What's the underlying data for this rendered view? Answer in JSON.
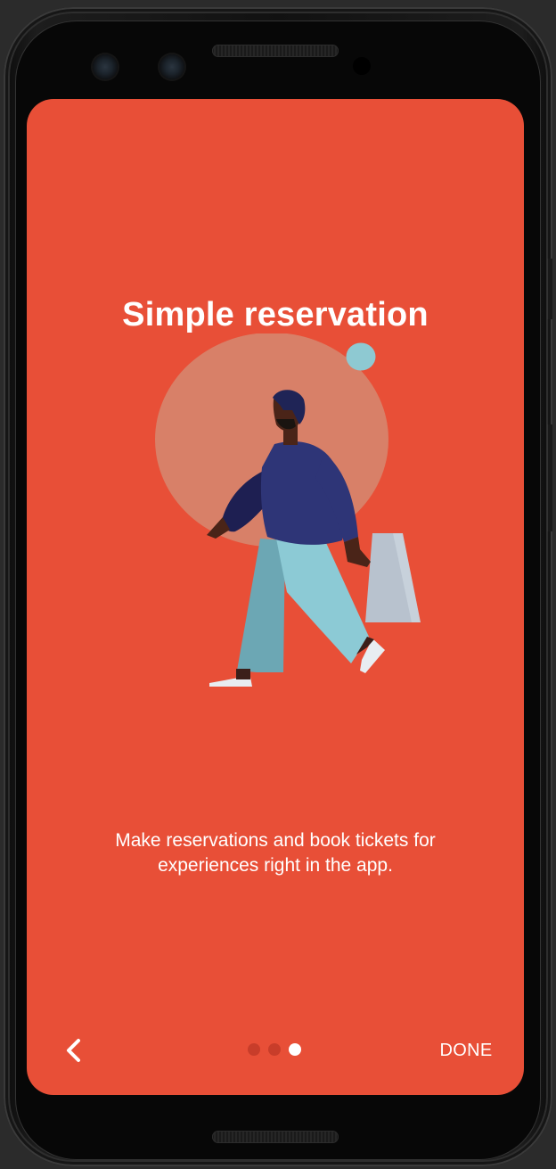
{
  "onboarding": {
    "title": "Simple reservation",
    "description": "Make reservations and book tickets for experiences right in the app.",
    "done_label": "DONE",
    "back_icon": "chevron-left-icon",
    "page_indicator": {
      "total": 3,
      "current": 3
    }
  },
  "theme": {
    "background": "#E84F37",
    "text": "#FFFFFF",
    "dot_inactive": "#C2402C",
    "dot_active": "#FFFFFF"
  }
}
